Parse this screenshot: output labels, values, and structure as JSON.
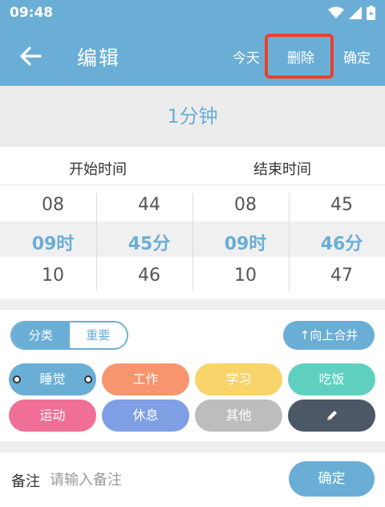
{
  "status": {
    "time": "09:48"
  },
  "header": {
    "title": "编辑",
    "today_label": "今天",
    "delete_label": "删除",
    "confirm_label": "确定"
  },
  "duration": "1分钟",
  "labels": {
    "start_time": "开始时间",
    "end_time": "结束时间"
  },
  "picker": {
    "start_hour": {
      "above": "08",
      "selected": "09时",
      "below": "10"
    },
    "start_minute": {
      "above": "44",
      "selected": "45分",
      "below": "46"
    },
    "end_hour": {
      "above": "08",
      "selected": "09时",
      "below": "10"
    },
    "end_minute": {
      "above": "45",
      "selected": "46分",
      "below": "47"
    }
  },
  "segment": {
    "category": "分类",
    "important": "重要"
  },
  "merge_label": "↑向上合并",
  "categories": [
    {
      "label": "睡觉",
      "color": "#6aaed6",
      "selected": true
    },
    {
      "label": "工作",
      "color": "#f7956e"
    },
    {
      "label": "学习",
      "color": "#f8d46a"
    },
    {
      "label": "吃饭",
      "color": "#5fd0c0"
    },
    {
      "label": "运动",
      "color": "#ef6f96"
    },
    {
      "label": "休息",
      "color": "#7f9fe4"
    },
    {
      "label": "其他",
      "color": "#bdbdbd"
    },
    {
      "label": "",
      "icon": "pencil-icon",
      "color": "#4d5866"
    }
  ],
  "note": {
    "label": "备注",
    "placeholder": "请输入备注",
    "value": "",
    "confirm_label": "确定"
  },
  "colors": {
    "accent": "#6aaed6",
    "highlight": "#e8412b"
  }
}
